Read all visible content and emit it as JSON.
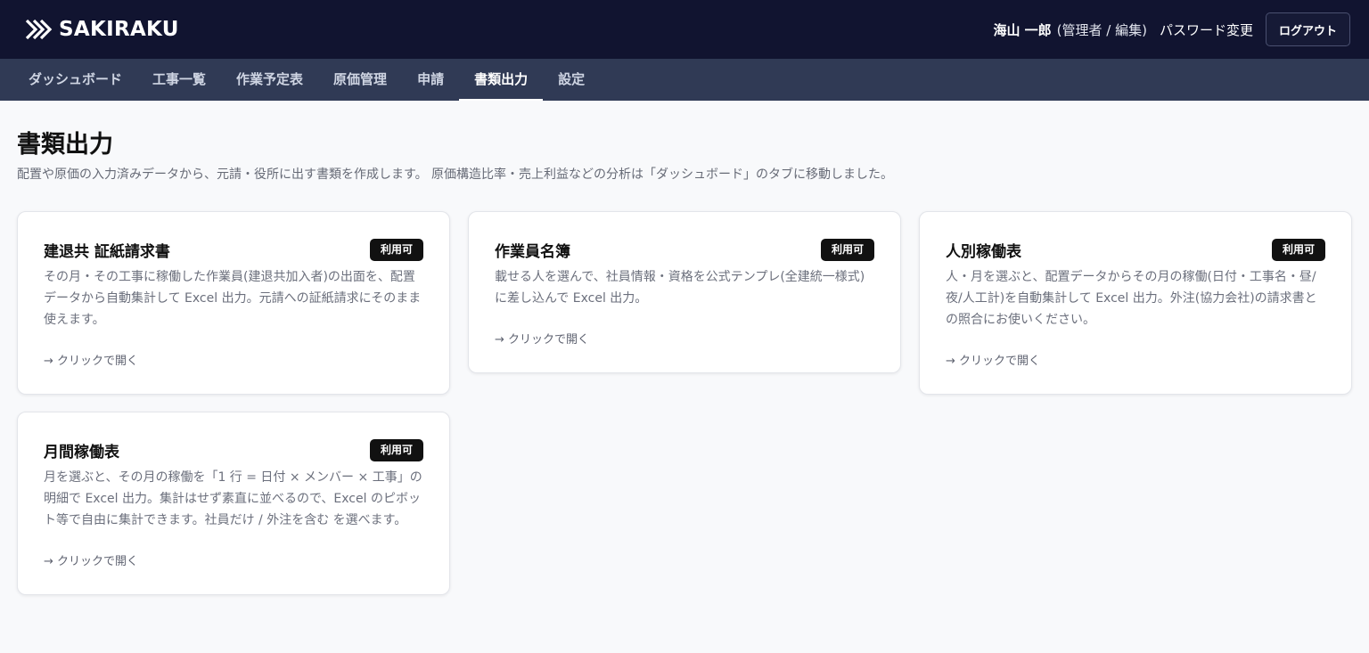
{
  "app": {
    "brand": "SAKIRAKU",
    "logo_icon": "double-chevron-logo-icon"
  },
  "header": {
    "user_name": "海山 一郎",
    "user_role": "(管理者 / 編集)",
    "password_link": "パスワード変更",
    "logout_label": "ログアウト"
  },
  "nav": {
    "tabs": [
      {
        "label": "ダッシュボード"
      },
      {
        "label": "工事一覧"
      },
      {
        "label": "作業予定表"
      },
      {
        "label": "原価管理"
      },
      {
        "label": "申請"
      },
      {
        "label": "書類出力"
      },
      {
        "label": "設定"
      }
    ],
    "active": "書類出力"
  },
  "page": {
    "title": "書類出力",
    "description": "配置や原価の入力済みデータから、元請・役所に出す書類を作成します。 原価構造比率・売上利益などの分析は「ダッシュボード」のタブに移動しました。"
  },
  "cards": [
    {
      "title": "建退共 証紙請求書",
      "badge": "利用可",
      "description": "その月・その工事に稼働した作業員(建退共加入者)の出面を、配置データから自動集計して Excel 出力。元請への証紙請求にそのまま使えます。",
      "link": "→ クリックで開く"
    },
    {
      "title": "作業員名簿",
      "badge": "利用可",
      "description": "載せる人を選んで、社員情報・資格を公式テンプレ(全建統一様式)に差し込んで Excel 出力。",
      "link": "→ クリックで開く"
    },
    {
      "title": "人別稼働表",
      "badge": "利用可",
      "description": "人・月を選ぶと、配置データからその月の稼働(日付・工事名・昼/夜/人工計)を自動集計して Excel 出力。外注(協力会社)の請求書との照合にお使いください。",
      "link": "→ クリックで開く"
    },
    {
      "title": "月間稼働表",
      "badge": "利用可",
      "description": "月を選ぶと、その月の稼働を「1 行 = 日付 × メンバー × 工事」の明細で Excel 出力。集計はせず素直に並べるので、Excel のピボット等で自由に集計できます。社員だけ / 外注を含む を選べます。",
      "link": "→ クリックで開く"
    }
  ],
  "colors": {
    "topbar": "#111430",
    "navbar": "#303a55",
    "badge": "#111111",
    "background": "#f8f9fb"
  }
}
